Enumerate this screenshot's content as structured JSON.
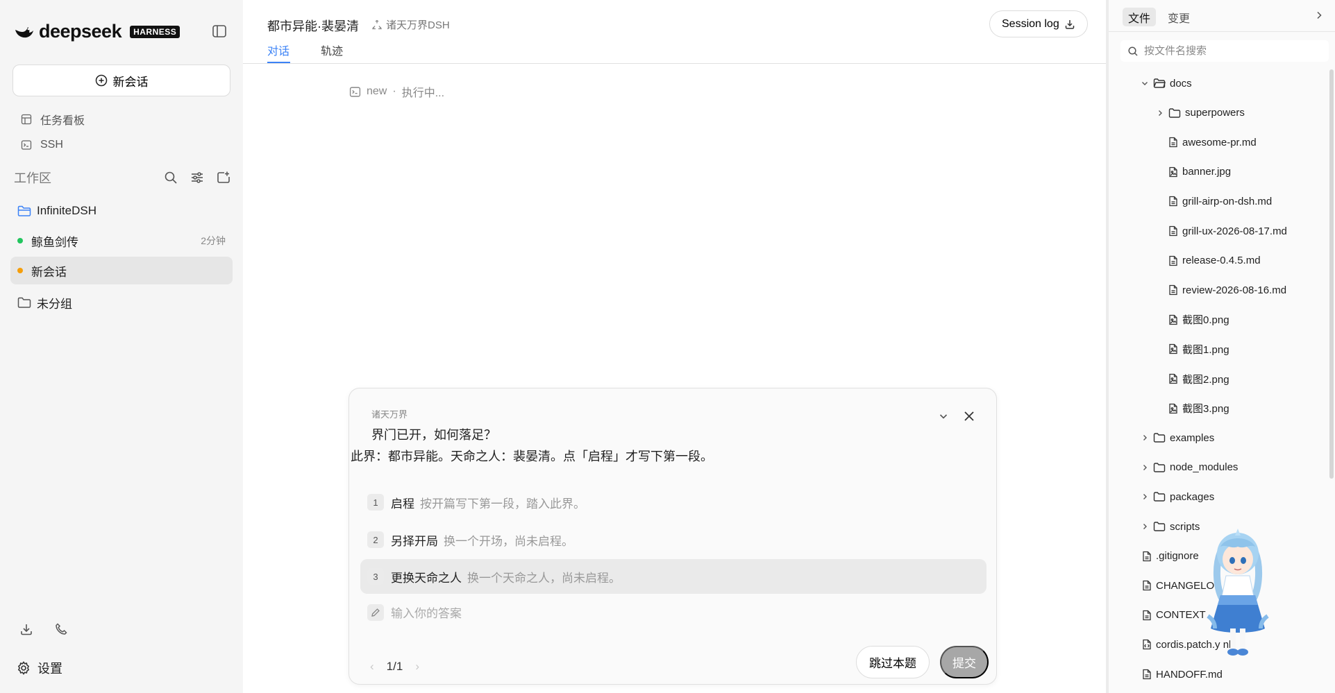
{
  "sidebar": {
    "brand": "deepseek",
    "badge": "HARNESS",
    "new_chat": "新会话",
    "nav": [
      {
        "label": "任务看板",
        "icon": "kanban-icon"
      },
      {
        "label": "SSH",
        "icon": "terminal-icon"
      }
    ],
    "workspace_title": "工作区",
    "workspace": [
      {
        "label": "InfiniteDSH",
        "kind": "folder-open",
        "color": "#3b82f6"
      },
      {
        "label": "鲸鱼剑传",
        "kind": "dot",
        "color": "#22c55e",
        "time": "2分钟"
      },
      {
        "label": "新会话",
        "kind": "dot",
        "color": "#f59e0b",
        "active": true
      },
      {
        "label": "未分组",
        "kind": "folder"
      }
    ],
    "settings": "设置"
  },
  "header": {
    "title": "都市异能·裴晏清",
    "tag": "诸天万界DSH",
    "session_log": "Session log",
    "tabs": [
      {
        "label": "对话",
        "active": true
      },
      {
        "label": "轨迹",
        "active": false
      }
    ]
  },
  "status": {
    "label": "new",
    "sep": "·",
    "state": "执行中..."
  },
  "question": {
    "source": "诸天万界",
    "question": "界门已开，如何落足？",
    "description": "此界：都市异能。天命之人：裴晏清。点「启程」才写下第一段。",
    "options": [
      {
        "num": "1",
        "label": "启程",
        "desc": "按开篇写下第一段，踏入此界。"
      },
      {
        "num": "2",
        "label": "另择开局",
        "desc": "换一个开场，尚未启程。"
      },
      {
        "num": "3",
        "label": "更换天命之人",
        "desc": "换一个天命之人，尚未启程。",
        "selected": true
      }
    ],
    "answer_placeholder": "输入你的答案",
    "pager": "1/1",
    "prev": "‹",
    "next": "›",
    "skip": "跳过本题",
    "submit": "提交"
  },
  "files_panel": {
    "tabs": [
      {
        "label": "文件",
        "active": true
      },
      {
        "label": "变更",
        "active": false
      }
    ],
    "search_placeholder": "按文件名搜索",
    "tree": [
      {
        "name": "docs",
        "type": "folder",
        "expanded": true,
        "depth": 1
      },
      {
        "name": "superpowers",
        "type": "folder",
        "expanded": false,
        "depth": 2
      },
      {
        "name": "awesome-pr.md",
        "type": "file",
        "depth": 2
      },
      {
        "name": "banner.jpg",
        "type": "image",
        "depth": 2
      },
      {
        "name": "grill-airp-on-dsh.md",
        "type": "file",
        "depth": 2
      },
      {
        "name": "grill-ux-2026-08-17.md",
        "type": "file",
        "depth": 2
      },
      {
        "name": "release-0.4.5.md",
        "type": "file",
        "depth": 2
      },
      {
        "name": "review-2026-08-16.md",
        "type": "file",
        "depth": 2
      },
      {
        "name": "截图0.png",
        "type": "image",
        "depth": 2
      },
      {
        "name": "截图1.png",
        "type": "image",
        "depth": 2
      },
      {
        "name": "截图2.png",
        "type": "image",
        "depth": 2
      },
      {
        "name": "截图3.png",
        "type": "image",
        "depth": 2
      },
      {
        "name": "examples",
        "type": "folder",
        "expanded": false,
        "depth": 1
      },
      {
        "name": "node_modules",
        "type": "folder",
        "expanded": false,
        "depth": 1
      },
      {
        "name": "packages",
        "type": "folder",
        "expanded": false,
        "depth": 1
      },
      {
        "name": "scripts",
        "type": "folder",
        "expanded": false,
        "depth": 1
      },
      {
        "name": ".gitignore",
        "type": "file",
        "depth": 0
      },
      {
        "name": "CHANGELO",
        "type": "file",
        "depth": 0
      },
      {
        "name": "CONTEXT",
        "type": "file",
        "depth": 0
      },
      {
        "name": "cordis.patch.y   nl",
        "type": "code",
        "depth": 0
      },
      {
        "name": "HANDOFF.md",
        "type": "file",
        "depth": 0
      }
    ]
  }
}
